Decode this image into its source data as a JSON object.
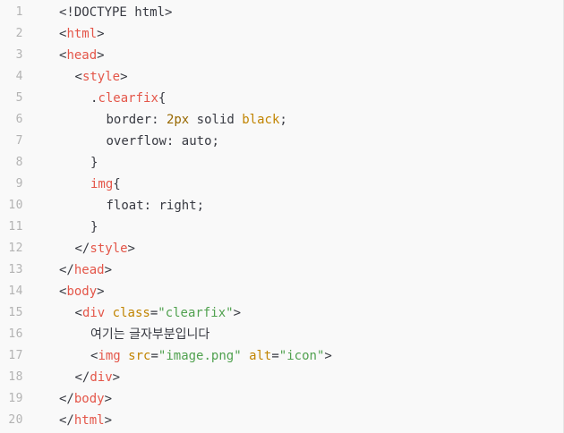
{
  "editor": {
    "language": "html",
    "colors": {
      "background": "#f9f9f9",
      "line_number": "#b3b3b3",
      "tag": "#e45649",
      "attribute": "#c18401",
      "string": "#50a14f",
      "number": "#986801",
      "plain": "#383a42"
    },
    "lines": [
      {
        "number": "1",
        "indent": 0,
        "tokens": [
          {
            "type": "plain",
            "text": "<!DOCTYPE html>"
          }
        ]
      },
      {
        "number": "2",
        "indent": 0,
        "tokens": [
          {
            "type": "plain",
            "text": "<"
          },
          {
            "type": "tag",
            "text": "html"
          },
          {
            "type": "plain",
            "text": ">"
          }
        ]
      },
      {
        "number": "3",
        "indent": 0,
        "tokens": [
          {
            "type": "plain",
            "text": "<"
          },
          {
            "type": "tag",
            "text": "head"
          },
          {
            "type": "plain",
            "text": ">"
          }
        ]
      },
      {
        "number": "4",
        "indent": 1,
        "tokens": [
          {
            "type": "plain",
            "text": "<"
          },
          {
            "type": "tag",
            "text": "style"
          },
          {
            "type": "plain",
            "text": ">"
          }
        ]
      },
      {
        "number": "5",
        "indent": 2,
        "tokens": [
          {
            "type": "plain",
            "text": "."
          },
          {
            "type": "tag",
            "text": "clearfix"
          },
          {
            "type": "plain",
            "text": "{"
          }
        ]
      },
      {
        "number": "6",
        "indent": 3,
        "tokens": [
          {
            "type": "plain",
            "text": "border: "
          },
          {
            "type": "num",
            "text": "2px"
          },
          {
            "type": "plain",
            "text": " solid "
          },
          {
            "type": "attr",
            "text": "black"
          },
          {
            "type": "plain",
            "text": ";"
          }
        ]
      },
      {
        "number": "7",
        "indent": 3,
        "tokens": [
          {
            "type": "plain",
            "text": "overflow: auto;"
          }
        ]
      },
      {
        "number": "8",
        "indent": 2,
        "tokens": [
          {
            "type": "plain",
            "text": "}"
          }
        ]
      },
      {
        "number": "9",
        "indent": 2,
        "tokens": [
          {
            "type": "tag",
            "text": "img"
          },
          {
            "type": "plain",
            "text": "{"
          }
        ]
      },
      {
        "number": "10",
        "indent": 3,
        "tokens": [
          {
            "type": "plain",
            "text": "float: right;"
          }
        ]
      },
      {
        "number": "11",
        "indent": 2,
        "tokens": [
          {
            "type": "plain",
            "text": "}"
          }
        ]
      },
      {
        "number": "12",
        "indent": 1,
        "tokens": [
          {
            "type": "plain",
            "text": "</"
          },
          {
            "type": "tag",
            "text": "style"
          },
          {
            "type": "plain",
            "text": ">"
          }
        ]
      },
      {
        "number": "13",
        "indent": 0,
        "tokens": [
          {
            "type": "plain",
            "text": "</"
          },
          {
            "type": "tag",
            "text": "head"
          },
          {
            "type": "plain",
            "text": ">"
          }
        ]
      },
      {
        "number": "14",
        "indent": 0,
        "tokens": [
          {
            "type": "plain",
            "text": "<"
          },
          {
            "type": "tag",
            "text": "body"
          },
          {
            "type": "plain",
            "text": ">"
          }
        ]
      },
      {
        "number": "15",
        "indent": 1,
        "tokens": [
          {
            "type": "plain",
            "text": "<"
          },
          {
            "type": "tag",
            "text": "div"
          },
          {
            "type": "plain",
            "text": " "
          },
          {
            "type": "attr",
            "text": "class"
          },
          {
            "type": "plain",
            "text": "="
          },
          {
            "type": "str",
            "text": "\"clearfix\""
          },
          {
            "type": "plain",
            "text": ">"
          }
        ]
      },
      {
        "number": "16",
        "indent": 2,
        "tokens": [
          {
            "type": "text",
            "text": "여기는 글자부분입니다"
          }
        ]
      },
      {
        "number": "17",
        "indent": 2,
        "tokens": [
          {
            "type": "plain",
            "text": "<"
          },
          {
            "type": "tag",
            "text": "img"
          },
          {
            "type": "plain",
            "text": " "
          },
          {
            "type": "attr",
            "text": "src"
          },
          {
            "type": "plain",
            "text": "="
          },
          {
            "type": "str",
            "text": "\"image.png\""
          },
          {
            "type": "plain",
            "text": " "
          },
          {
            "type": "attr",
            "text": "alt"
          },
          {
            "type": "plain",
            "text": "="
          },
          {
            "type": "str",
            "text": "\"icon\""
          },
          {
            "type": "plain",
            "text": ">"
          }
        ]
      },
      {
        "number": "18",
        "indent": 1,
        "tokens": [
          {
            "type": "plain",
            "text": "</"
          },
          {
            "type": "tag",
            "text": "div"
          },
          {
            "type": "plain",
            "text": ">"
          }
        ]
      },
      {
        "number": "19",
        "indent": 0,
        "tokens": [
          {
            "type": "plain",
            "text": "</"
          },
          {
            "type": "tag",
            "text": "body"
          },
          {
            "type": "plain",
            "text": ">"
          }
        ]
      },
      {
        "number": "20",
        "indent": 0,
        "tokens": [
          {
            "type": "plain",
            "text": "</"
          },
          {
            "type": "tag",
            "text": "html"
          },
          {
            "type": "plain",
            "text": ">"
          }
        ]
      }
    ]
  }
}
